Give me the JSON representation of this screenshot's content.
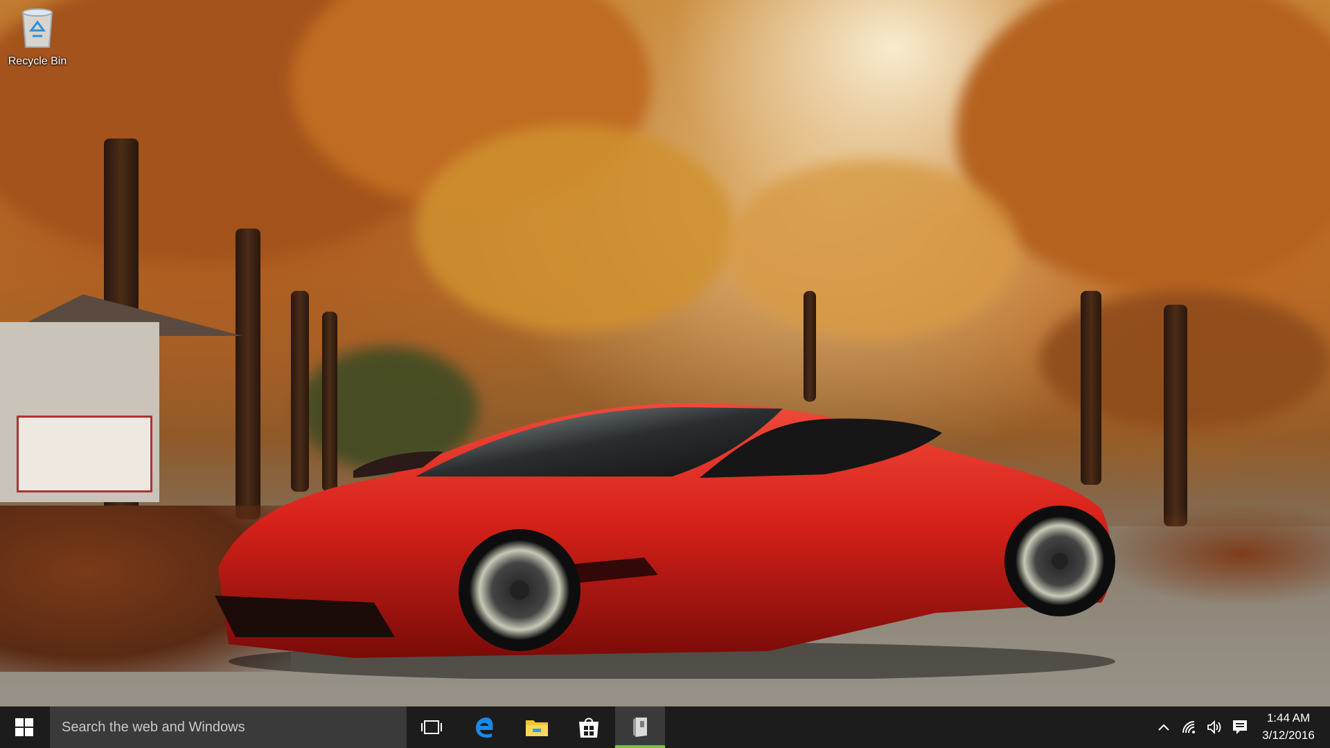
{
  "desktop": {
    "icons": [
      {
        "label": "Recycle Bin",
        "icon": "recycle-bin-icon"
      }
    ]
  },
  "taskbar": {
    "start_icon": "windows-logo-icon",
    "search": {
      "placeholder": "Search the web and Windows",
      "icon": "search-box"
    },
    "pinned": [
      {
        "name": "Task View",
        "icon": "task-view-icon"
      },
      {
        "name": "Microsoft Edge",
        "icon": "edge-icon"
      },
      {
        "name": "File Explorer",
        "icon": "folder-icon"
      },
      {
        "name": "Store",
        "icon": "store-icon"
      },
      {
        "name": "Open app",
        "icon": "app-icon",
        "active": true
      }
    ],
    "tray": {
      "icons": [
        "chevron-up-icon",
        "network-icon",
        "volume-icon",
        "notifications-icon"
      ],
      "time": "1:44 AM",
      "date": "3/12/2016"
    },
    "accent_color": "#7ac143",
    "background_color": "#1c1c1c"
  }
}
